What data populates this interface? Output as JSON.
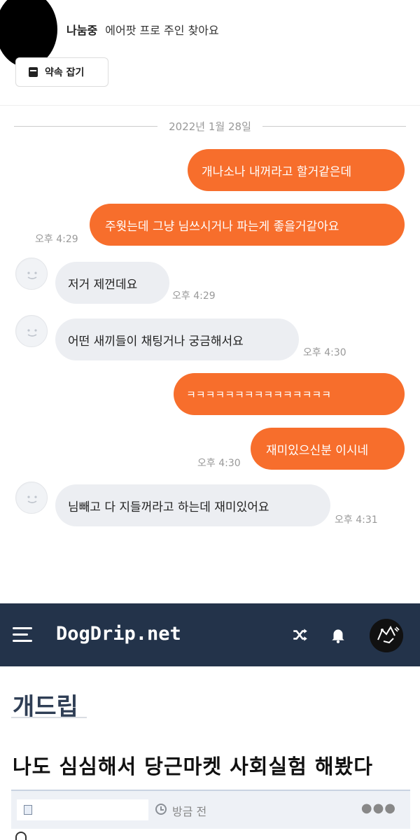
{
  "chat": {
    "status": "나눔중",
    "item_title": "에어팟 프로 주인 찾아요",
    "appointment_button": "약속 잡기",
    "date": "2022년 1월 28일",
    "messages": [
      {
        "side": "mine",
        "text": "개나소나 내꺼라고 할거같은데",
        "time": ""
      },
      {
        "side": "mine",
        "text": "주웟는데 그냥 님쓰시거나 파는게 좋을거같아요",
        "time": "오후 4:29"
      },
      {
        "side": "theirs",
        "text": "저거 제껀데요",
        "time": "오후 4:29"
      },
      {
        "side": "theirs",
        "text": "어떤 새끼들이 채팅거나 궁금해서요",
        "time": "오후 4:30"
      },
      {
        "side": "mine",
        "text": "ㅋㅋㅋㅋㅋㅋㅋㅋㅋㅋㅋㅋㅋㅋㅋ",
        "time": ""
      },
      {
        "side": "mine",
        "text": "재미있으신분 이시네",
        "time": "오후 4:30"
      },
      {
        "side": "theirs",
        "text": "님빼고 다 지들꺼라고 하는데 재미있어요",
        "time": "오후 4:31"
      }
    ]
  },
  "site": {
    "logo": "DogDrip.net",
    "nav_color": "#23334a",
    "accent_color": "#f76e2c",
    "icons": [
      "menu-icon",
      "shuffle-icon",
      "bell-icon",
      "profile-avatar"
    ]
  },
  "board": {
    "name": "개드립",
    "post_title": "나도 심심해서 당근마켓 사회실험 해봤다",
    "time_ago": "방금 전",
    "more": "●●●"
  }
}
